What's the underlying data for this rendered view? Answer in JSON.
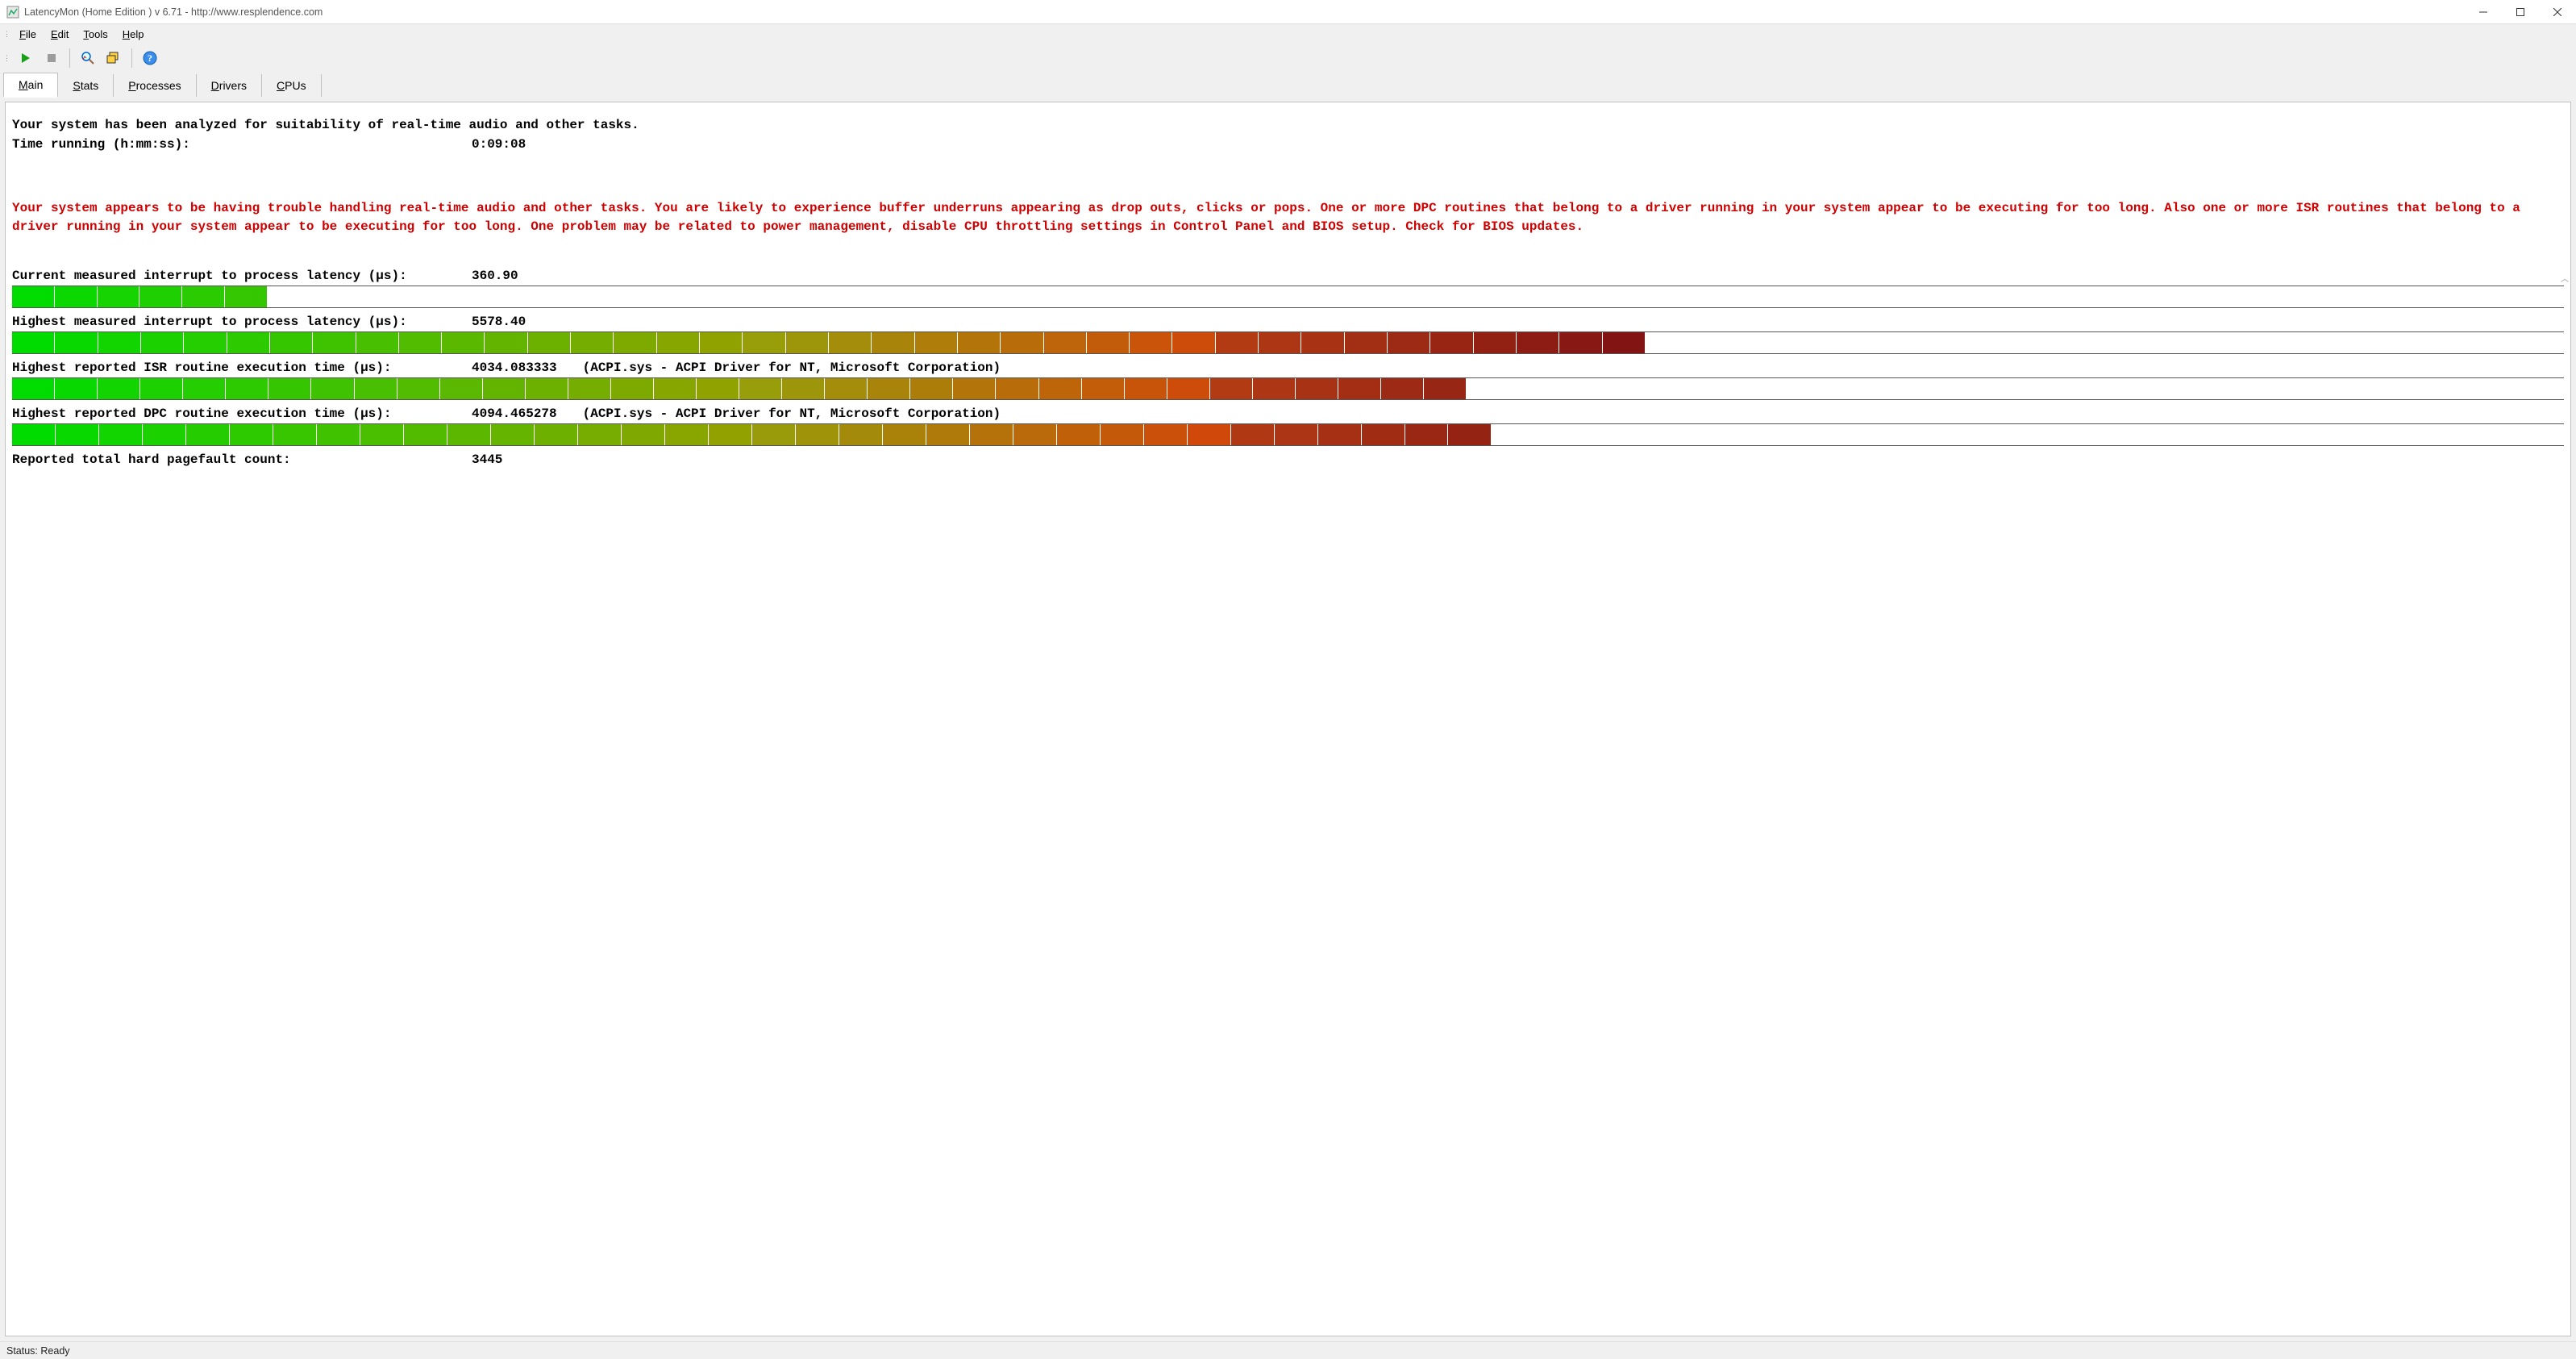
{
  "window": {
    "title": "LatencyMon  (Home Edition )  v 6.71 - http://www.resplendence.com"
  },
  "menu": {
    "file": "File",
    "edit": "Edit",
    "tools": "Tools",
    "help": "Help"
  },
  "toolbar": {
    "play": "play",
    "stop": "stop",
    "analyze": "analyze",
    "windows": "windows",
    "help": "help"
  },
  "tabs": {
    "main": "Main",
    "stats": "Stats",
    "processes": "Processes",
    "drivers": "Drivers",
    "cpus": "CPUs"
  },
  "summary": {
    "headline": "Your system has been analyzed for suitability of real-time audio and other tasks.",
    "time_label": "Time running (h:mm:ss):",
    "time_value": "0:09:08",
    "alert": "Your system appears to be having trouble handling real-time audio and other tasks. You are likely to experience buffer underruns appearing as drop outs, clicks or pops. One or more DPC routines that belong to a driver running in your system appear to be executing for too long. Also one or more ISR routines that belong to a driver running in your system appear to be executing for too long. One problem may be related to power management, disable CPU throttling settings in Control Panel and BIOS setup. Check for BIOS updates."
  },
  "metrics": [
    {
      "label": "Current measured interrupt to process latency (µs):",
      "value": "360.90",
      "detail": "",
      "bar_pct": 10,
      "segments": 6
    },
    {
      "label": "Highest measured interrupt to process latency (µs):",
      "value": "5578.40",
      "detail": "",
      "bar_pct": 64,
      "segments": 38
    },
    {
      "label": "Highest reported ISR routine execution time (µs):",
      "value": "4034.083333",
      "detail": "(ACPI.sys - ACPI Driver for NT, Microsoft Corporation)",
      "bar_pct": 57,
      "segments": 34
    },
    {
      "label": "Highest reported DPC routine execution time (µs):",
      "value": "4094.465278",
      "detail": "(ACPI.sys - ACPI Driver for NT, Microsoft Corporation)",
      "bar_pct": 58,
      "segments": 34
    },
    {
      "label": "Reported total hard pagefault count:",
      "value": "3445",
      "detail": "",
      "bar_pct": 0,
      "segments": 0
    }
  ],
  "status": {
    "text": "Status: Ready"
  },
  "chart_data": {
    "type": "bar",
    "title": "LatencyMon latency metrics",
    "xlabel": "",
    "ylabel": "µs",
    "categories": [
      "Current interrupt→process latency",
      "Highest interrupt→process latency",
      "Highest ISR routine execution time",
      "Highest DPC routine execution time"
    ],
    "values": [
      360.9,
      5578.4,
      4034.083333,
      4094.465278
    ],
    "ylim": [
      0,
      6000
    ],
    "annotations": {
      "isr_source": "ACPI.sys - ACPI Driver for NT, Microsoft Corporation",
      "dpc_source": "ACPI.sys - ACPI Driver for NT, Microsoft Corporation",
      "hard_pagefault_count": 3445,
      "time_running": "0:09:08"
    }
  }
}
